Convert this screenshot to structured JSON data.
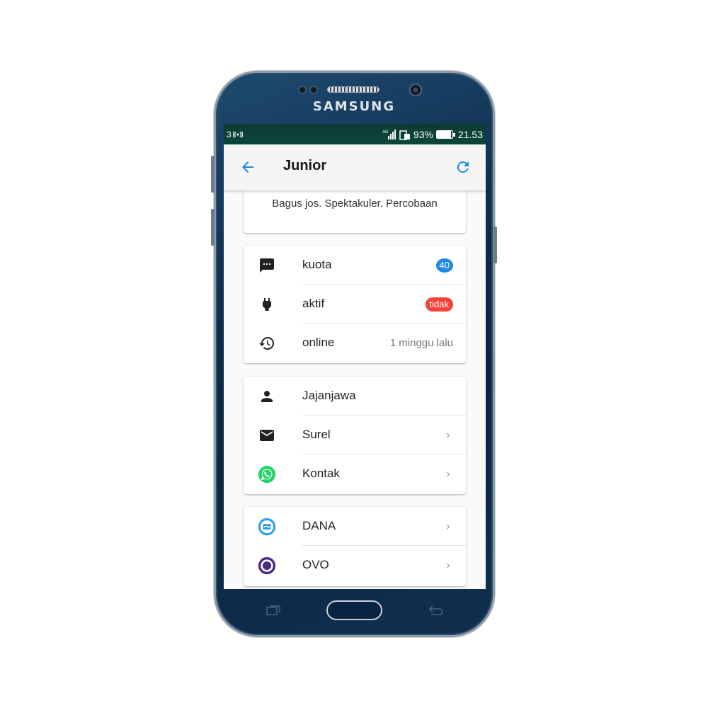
{
  "device": {
    "brand": "SAMSUNG"
  },
  "statusbar": {
    "carrier": "3",
    "battery_percent": "93%",
    "battery_level": 0.93,
    "time": "21.53"
  },
  "appbar": {
    "title": "Junior",
    "back_icon": "arrow-back-icon",
    "refresh_icon": "refresh-icon"
  },
  "description": {
    "text": "Bagus jos. Spektakuler. Percobaan"
  },
  "stats": [
    {
      "icon": "message-icon",
      "label": "kuota",
      "badge": "40",
      "badge_color": "#1e88e5"
    },
    {
      "icon": "plug-icon",
      "label": "aktif",
      "badge": "tidak",
      "badge_color": "#f44336"
    },
    {
      "icon": "history-icon",
      "label": "online",
      "value": "1 minggu lalu"
    }
  ],
  "contacts": [
    {
      "icon": "person-icon",
      "label": "Jajanjawa"
    },
    {
      "icon": "mail-icon",
      "label": "Surel"
    },
    {
      "icon": "whatsapp-icon",
      "label": "Kontak"
    }
  ],
  "wallets": [
    {
      "icon": "dana-icon",
      "label": "DANA"
    },
    {
      "icon": "ovo-icon",
      "label": "OVO"
    }
  ],
  "colors": {
    "accent": "#1e88e5",
    "statusbar": "#0b463a",
    "appbar": "#f5f5f5",
    "danger": "#f44336",
    "whatsapp": "#25d366",
    "dana": "#2f9be8",
    "ovo": "#4c2a86"
  }
}
